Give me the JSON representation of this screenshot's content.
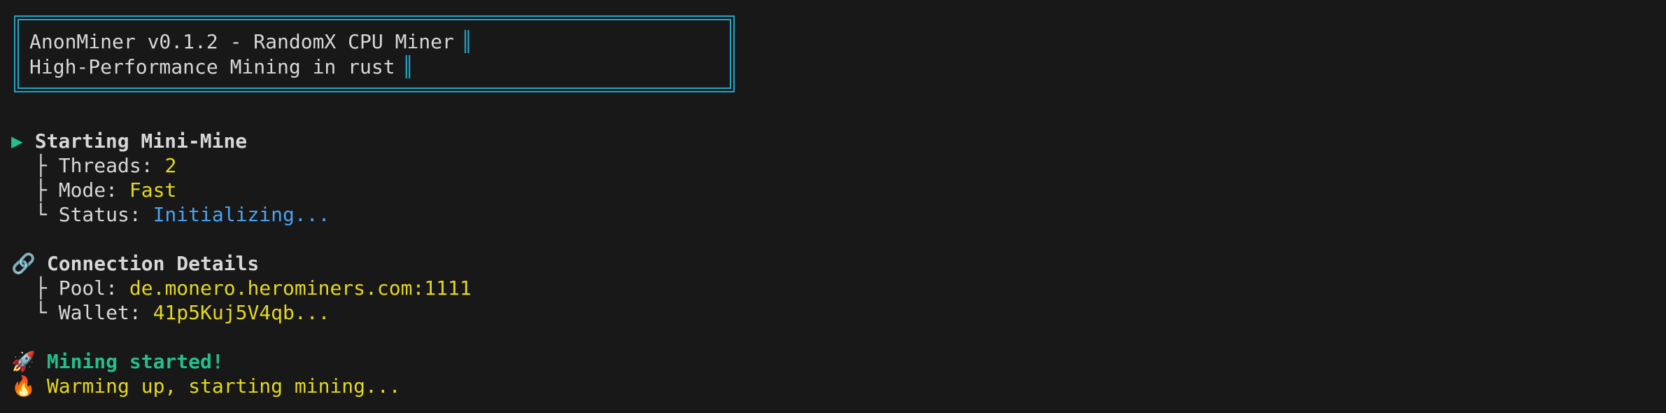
{
  "banner": {
    "title": "AnonMiner v0.1.2 - RandomX CPU Miner",
    "subtitle": "High-Performance Mining in rust"
  },
  "start_section": {
    "bullet": "▶",
    "heading": "Starting Mini-Mine",
    "threads_label": "Threads: ",
    "threads_value": "2",
    "mode_label": "Mode: ",
    "mode_value": "Fast",
    "status_label": "Status: ",
    "status_value": "Initializing..."
  },
  "connection_section": {
    "icon": "🔗",
    "heading": "Connection Details",
    "pool_label": "Pool: ",
    "pool_value": "de.monero.herominers.com:1111",
    "wallet_label": "Wallet: ",
    "wallet_value": "41p5Kuj5V4qb..."
  },
  "events": {
    "started_icon": "🚀",
    "started": "Mining started!",
    "warming_icon": "🔥",
    "warming": "Warming up, starting mining..."
  },
  "colors": {
    "background": "#181818",
    "border": "#1fa6c9",
    "green": "#22c08a",
    "yellow": "#e5d81c",
    "blue": "#4aa3f0"
  }
}
